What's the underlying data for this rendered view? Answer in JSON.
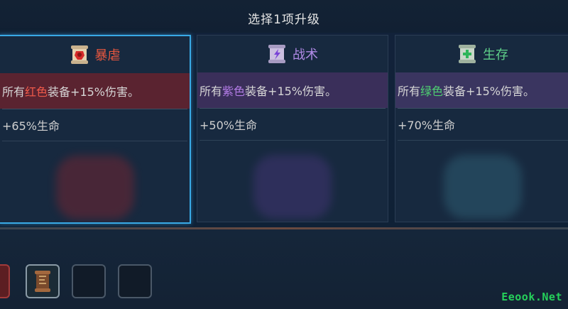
{
  "header": {
    "title": "选择1项升级"
  },
  "cards": [
    {
      "name": "暴虐",
      "name_color": "#e8573f",
      "desc_prefix": "所有",
      "desc_color_word": "红色",
      "desc_color_hex": "#f05a4a",
      "desc_suffix": "装备+15%伤害。",
      "desc_bg": "#5a2330",
      "stat": "+65%生命",
      "icon": "red-scroll-icon",
      "selected": true
    },
    {
      "name": "战术",
      "name_color": "#b08ae6",
      "desc_prefix": "所有",
      "desc_color_word": "紫色",
      "desc_color_hex": "#b37ce6",
      "desc_suffix": "装备+15%伤害。",
      "desc_bg": "#3a2f5a",
      "stat": "+50%生命",
      "icon": "purple-scroll-icon",
      "selected": false
    },
    {
      "name": "生存",
      "name_color": "#5fd08a",
      "desc_prefix": "所有",
      "desc_color_word": "绿色",
      "desc_color_hex": "#4fd072",
      "desc_suffix": "装备+15%伤害。",
      "desc_bg": "#3a3560",
      "stat": "+70%生命",
      "icon": "green-scroll-icon",
      "selected": false
    }
  ],
  "inventory": {
    "slots": [
      "empty",
      "scroll",
      "empty",
      "empty"
    ]
  },
  "watermark": "Eeook.Net"
}
